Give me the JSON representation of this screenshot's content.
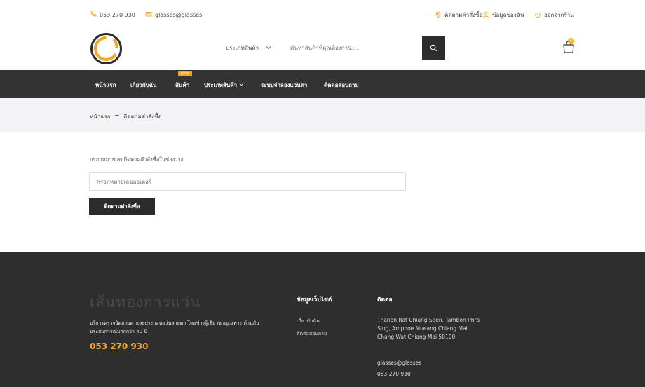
{
  "topbar": {
    "phone": "053 270 930",
    "email": "glasses@glasses",
    "track_order": "ติดตามคำสั่งซื้อ",
    "my_account": "ข้อมูลของฉัน",
    "logout": "ออกจากร้าน"
  },
  "header": {
    "category_select": "ประเภทสินค้า",
    "search_placeholder": "ค้นหาสินค้าที่คุณต้องการ....",
    "cart_count": "0"
  },
  "nav": {
    "home": "หน้าแรก",
    "about": "เกี่ยวกับฉัน",
    "products": "สินค้า",
    "new_badge": "NEW",
    "categories": "ประเภทสินค้า",
    "try_on": "ระบบจำลองแว่นตา",
    "contact": "ติดต่อสอบถาม"
  },
  "breadcrumb": {
    "home": "หน้าแรก",
    "separator": "→",
    "current": "ติดตามคำสั่งซื้อ"
  },
  "main": {
    "instruction": "กรอกหมายเลขติดตามคำสั่งซื้อในช่องว่าง",
    "input_placeholder": "กรอกหมายเลขออเดอร์",
    "button_label": "ติดตามคำสั่งซื้อ"
  },
  "footer": {
    "brand": "เส้นทองการแว่น",
    "description": "บริการตรวจวัดสายตาและประกอบแว่นสายตา โดยช่างผู้เชี่ยวชาญเฉพาะ ด้านกับประสบการณ์มากกว่า 40 ปี",
    "phone": "053 270 930",
    "info_title": "ข้อมูลเว็บไซต์",
    "info_links": [
      "เกี่ยวกับฉัน",
      "ติดต่อสอบถาม"
    ],
    "contact_title": "ติดต่อ",
    "address": "Thanon Rat Chiang Saen, Tambon Phra Sing, Amphoe Mueang Chiang Mai, Chang Wat Chiang Mai 50100",
    "email": "glasses@glasses",
    "phone2": "053 270 930"
  },
  "colors": {
    "accent": "#f5a623",
    "nav_bg": "#333333",
    "footer_bg": "#2e2e2e",
    "breadcrumb_bg": "#f3f3f5"
  },
  "icons": [
    "phone-icon",
    "mail-icon",
    "location-pin-icon",
    "user-icon",
    "power-icon",
    "search-icon",
    "chevron-down-icon",
    "cart-icon",
    "logo-ring-icon"
  ]
}
